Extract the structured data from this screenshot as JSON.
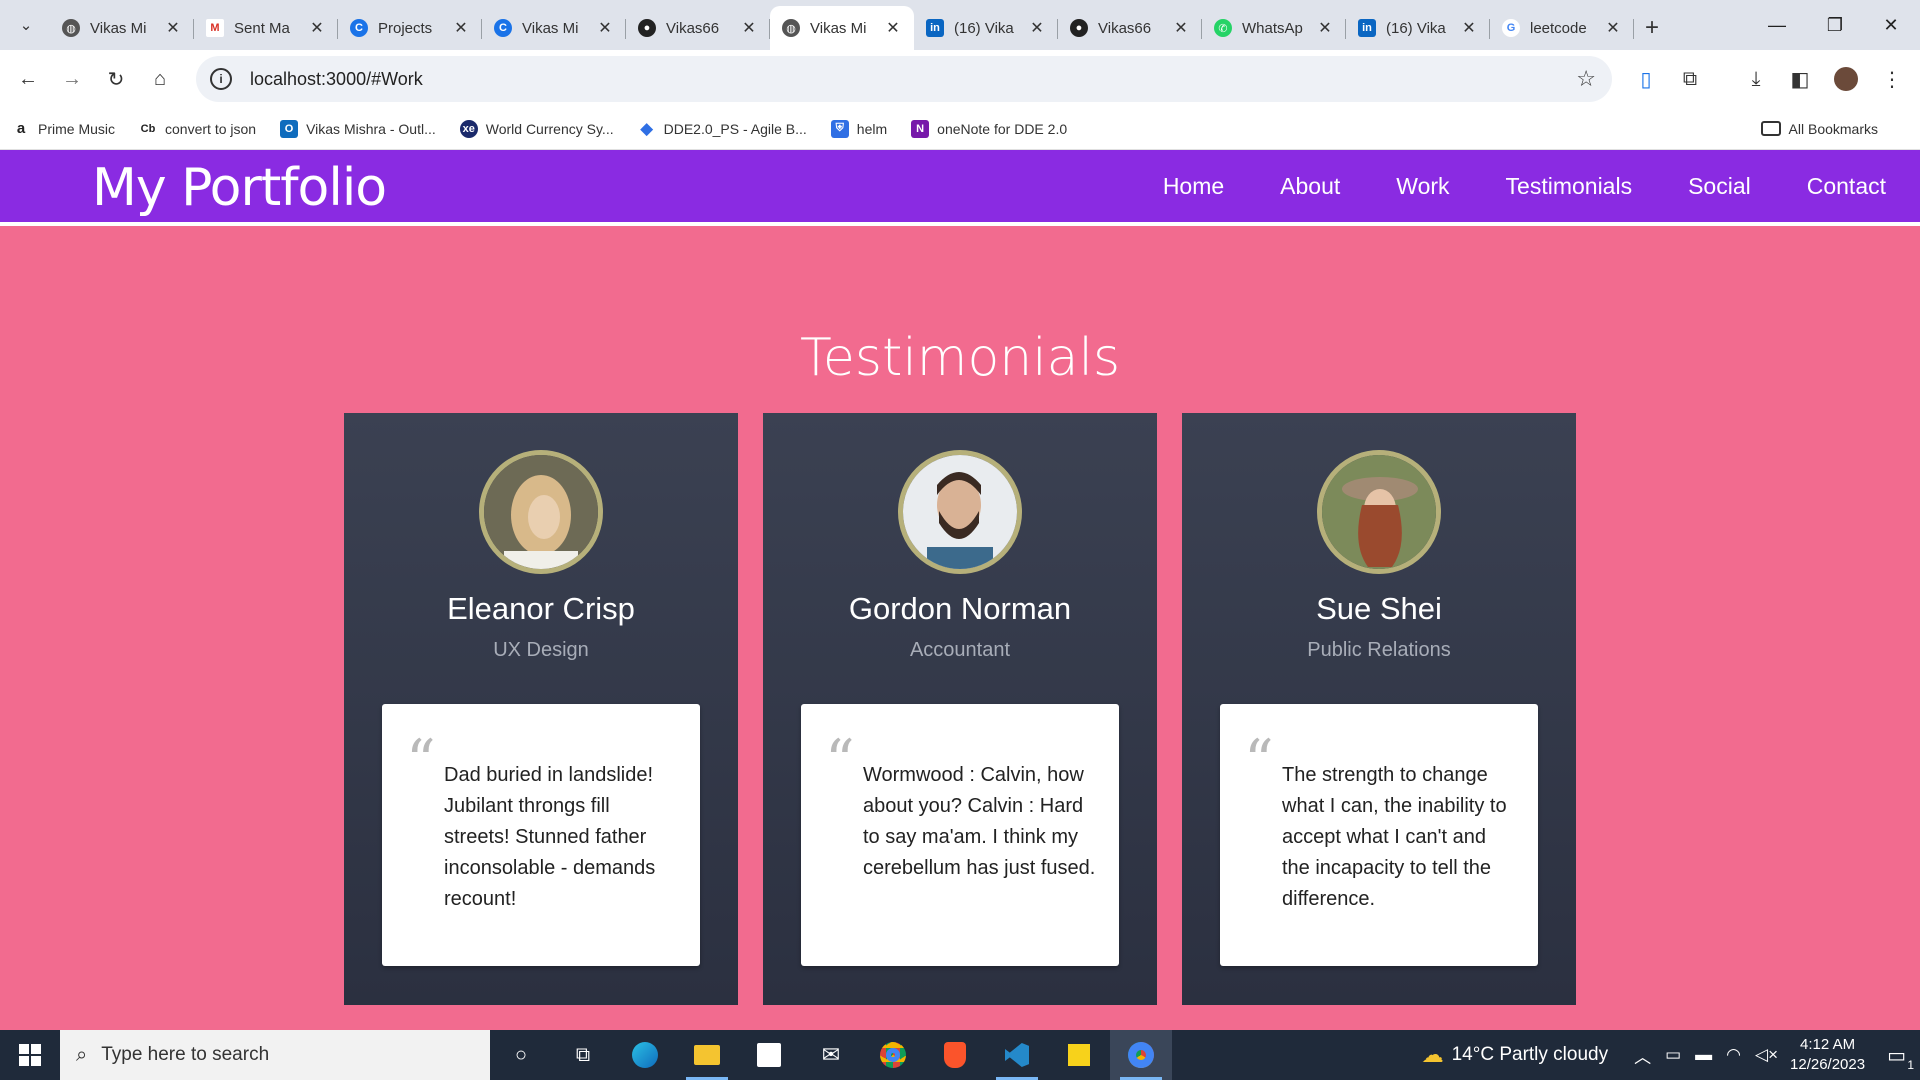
{
  "browser": {
    "tabs": [
      {
        "title": "Vikas Mi",
        "icon": "globe-icon",
        "active": false
      },
      {
        "title": "Sent Ma",
        "icon": "gmail-icon",
        "active": false
      },
      {
        "title": "Projects",
        "icon": "app-icon",
        "active": false
      },
      {
        "title": "Vikas Mi",
        "icon": "app-icon",
        "active": false
      },
      {
        "title": "Vikas66",
        "icon": "github-icon",
        "active": false
      },
      {
        "title": "Vikas Mi",
        "icon": "globe-icon",
        "active": true
      },
      {
        "title": "(16) Vika",
        "icon": "linkedin-icon",
        "active": false
      },
      {
        "title": "Vikas66",
        "icon": "github-icon",
        "active": false
      },
      {
        "title": "WhatsAp",
        "icon": "whatsapp-icon",
        "active": false
      },
      {
        "title": "(16) Vika",
        "icon": "linkedin-icon",
        "active": false
      },
      {
        "title": "leetcode",
        "icon": "google-icon",
        "active": false
      }
    ],
    "url": "localhost:3000/#Work",
    "bookmarks": [
      {
        "label": "Prime Music",
        "icon": "amazon-icon"
      },
      {
        "label": "convert to json",
        "icon": "cb-icon"
      },
      {
        "label": "Vikas Mishra - Outl...",
        "icon": "outlook-icon"
      },
      {
        "label": "World Currency Sy...",
        "icon": "xe-icon"
      },
      {
        "label": "DDE2.0_PS - Agile B...",
        "icon": "diamond-icon"
      },
      {
        "label": "helm",
        "icon": "shield-icon"
      },
      {
        "label": "oneNote for DDE 2.0",
        "icon": "onenote-icon"
      }
    ],
    "all_bookmarks": "All Bookmarks"
  },
  "page": {
    "brand": "My Portfolio",
    "nav": [
      "Home",
      "About",
      "Work",
      "Testimonials",
      "Social",
      "Contact"
    ],
    "section_title": "Testimonials",
    "testimonials": [
      {
        "name": "Eleanor Crisp",
        "role": "UX Design",
        "quote": "Dad buried in landslide! Jubilant throngs fill streets! Stunned father inconsolable - demands recount!"
      },
      {
        "name": "Gordon Norman",
        "role": "Accountant",
        "quote": "Wormwood : Calvin, how about you? Calvin : Hard to say ma'am. I think my cerebellum has just fused."
      },
      {
        "name": "Sue Shei",
        "role": "Public Relations",
        "quote": "The strength to change what I can, the inability to accept what I can't and the incapacity to tell the difference."
      }
    ]
  },
  "taskbar": {
    "search_placeholder": "Type here to search",
    "weather": "14°C  Partly cloudy",
    "time": "4:12 AM",
    "date": "12/26/2023",
    "notification_count": "1"
  }
}
